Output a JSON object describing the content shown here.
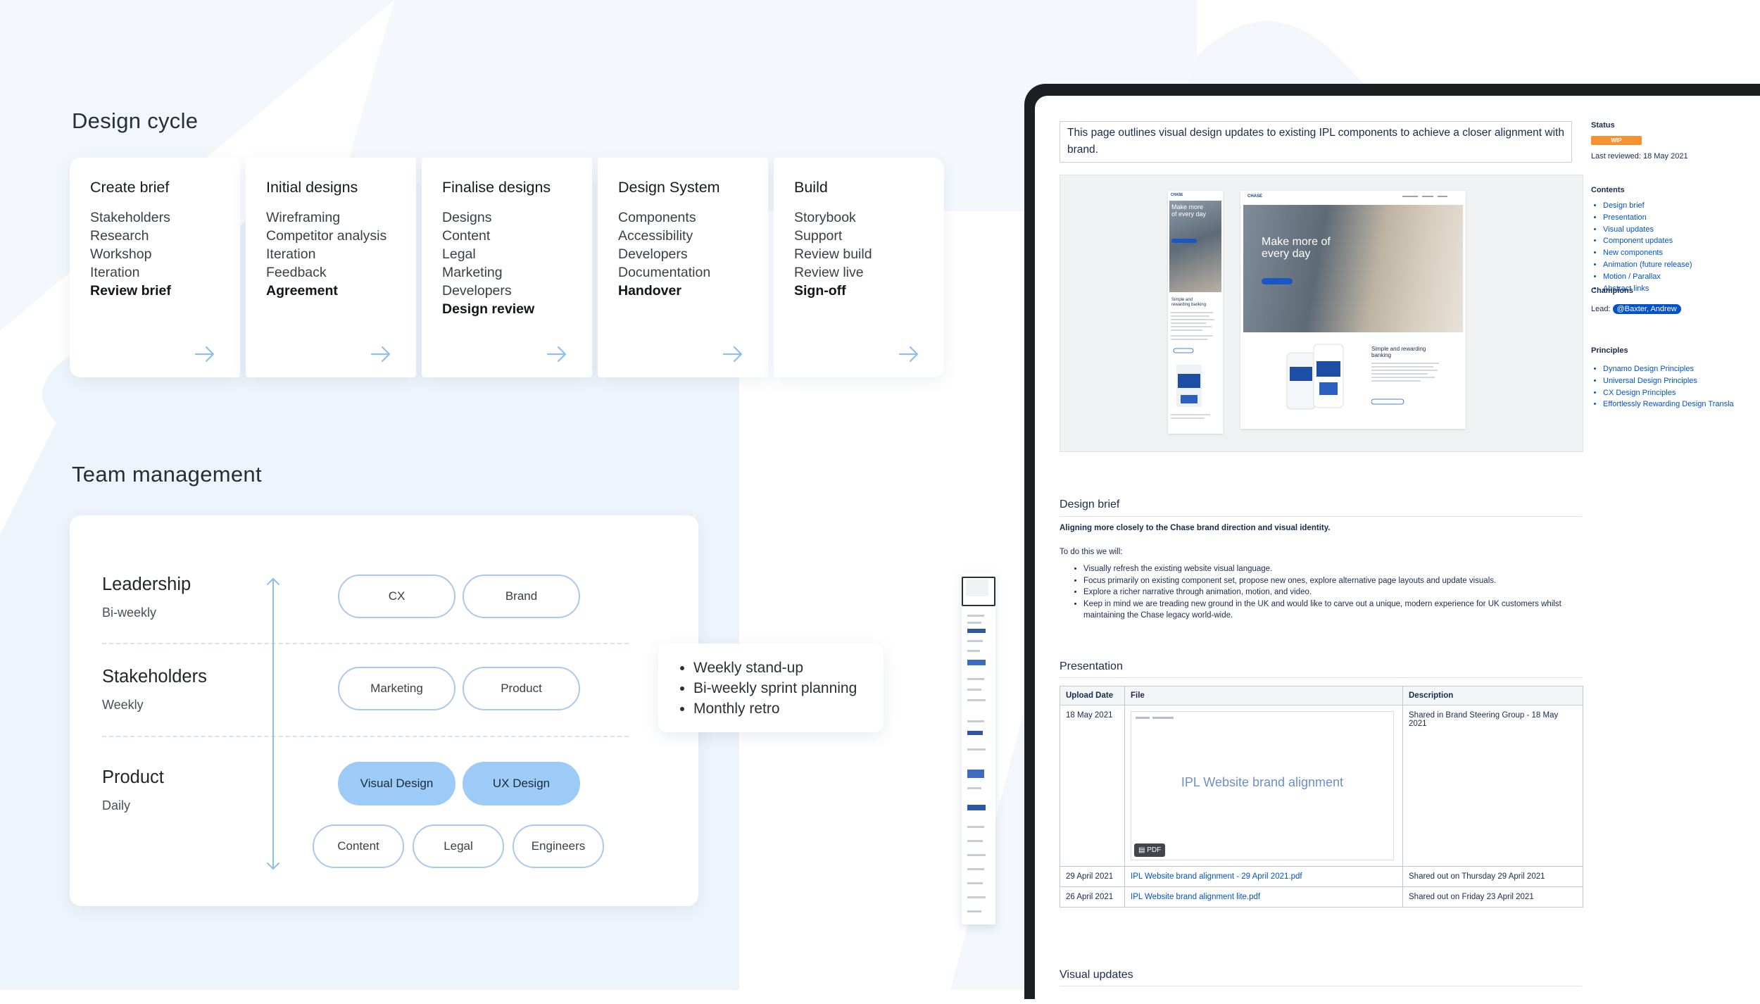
{
  "design_cycle": {
    "title": "Design cycle",
    "stages": [
      {
        "title": "Create brief",
        "items": [
          "Stakeholders",
          "Research",
          "Workshop",
          "Iteration"
        ],
        "final": "Review brief"
      },
      {
        "title": "Initial designs",
        "items": [
          "Wireframing",
          "Competitor analysis",
          "Iteration",
          "Feedback"
        ],
        "final": "Agreement"
      },
      {
        "title": "Finalise designs",
        "items": [
          "Designs",
          "Content",
          "Legal",
          "Marketing",
          "Developers"
        ],
        "final": "Design review"
      },
      {
        "title": "Design System",
        "items": [
          "Components",
          "Accessibility",
          "Developers",
          "Documentation"
        ],
        "final": "Handover"
      },
      {
        "title": "Build",
        "items": [
          "Storybook",
          "Support",
          "Review build",
          "Review live"
        ],
        "final": "Sign-off"
      }
    ]
  },
  "team": {
    "title": "Team management",
    "roles": [
      {
        "name": "Leadership",
        "freq": "Bi-weekly",
        "pills": [
          "CX",
          "Brand"
        ]
      },
      {
        "name": "Stakeholders",
        "freq": "Weekly",
        "pills": [
          "Marketing",
          "Product"
        ]
      },
      {
        "name": "Product",
        "freq": "Daily",
        "pills": [
          "Visual Design",
          "UX Design"
        ],
        "sub_pills": [
          "Content",
          "Legal",
          "Engineers"
        ]
      }
    ],
    "meetings": [
      "Weekly stand-up",
      "Bi-weekly sprint planning",
      "Monthly retro"
    ]
  },
  "doc": {
    "summary": "This page outlines visual design updates to existing IPL components to achieve a closer alignment with brand.",
    "hero": {
      "mobile_heading": "Make more of every day",
      "desktop_heading": "Make more of every day",
      "desktop_sub": "Simple and rewarding banking",
      "mobile_sub": "Simple and rewarding banking",
      "brand": "CHASE"
    },
    "design_brief": {
      "heading": "Design brief",
      "lead": "Aligning more closely to the Chase brand direction and visual identity.",
      "intro": "To do this we will:",
      "bullets": [
        "Visually refresh the existing website visual language.",
        "Focus primarily on existing component set, propose new ones, explore alternative page layouts and update visuals.",
        "Explore a richer narrative through animation, motion, and video.",
        "Keep in mind we are treading new ground in the UK and would like to carve out a unique, modern experience for UK customers whilst maintaining the Chase legacy world-wide."
      ]
    },
    "presentation": {
      "heading": "Presentation",
      "columns": [
        "Upload Date",
        "File",
        "Description"
      ],
      "rows": [
        {
          "date": "18 May 2021",
          "file_preview_title": "IPL Website brand alignment",
          "file_badge": "PDF",
          "desc": "Shared in Brand Steering Group - 18 May 2021"
        },
        {
          "date": "29 April 2021",
          "file": "IPL Website brand alignment - 29 April 2021.pdf",
          "desc": "Shared out on Thursday 29 April 2021"
        },
        {
          "date": "26 April 2021",
          "file": "IPL Website brand alignment lite.pdf",
          "desc": "Shared out on Friday 23 April 2021"
        }
      ]
    },
    "visual_updates_heading": "Visual updates",
    "sidebar": {
      "status_label": "Status",
      "status_value": "WIP",
      "last_reviewed": "Last reviewed: 18 May 2021",
      "contents_label": "Contents",
      "contents": [
        "Design brief",
        "Presentation",
        "Visual updates",
        "Component updates",
        "New components",
        "Animation (future release)",
        "Motion / Parallax",
        "Abstract links"
      ],
      "champions_label": "Champions",
      "lead_label": "Lead:",
      "lead_value": "@Baxter, Andrew",
      "principles_label": "Principles",
      "principles": [
        "Dynamo Design Principles",
        "Universal Design Principles",
        "CX Design Principles",
        "Effortlessly Rewarding Design Transla"
      ]
    }
  },
  "colors": {
    "accent": "#9ccbf7",
    "pill_border": "#a9c9ee",
    "link": "#0052cc",
    "wip": "#f79232"
  }
}
